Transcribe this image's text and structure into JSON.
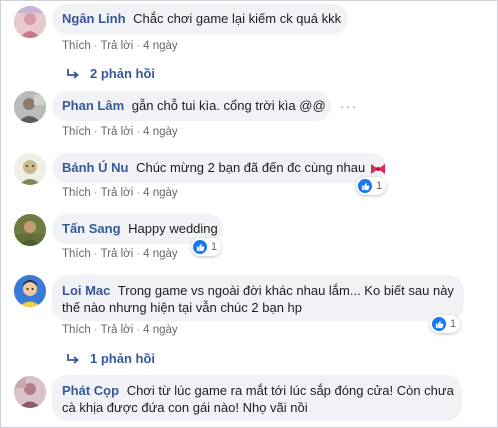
{
  "actions": {
    "like": "Thích",
    "reply": "Trả lời",
    "separator": "·"
  },
  "comments": [
    {
      "author": "Ngân Linh",
      "text": "Chắc chơi game lại kiếm ck quá kkk",
      "time": "4 ngày",
      "replies_label": "2 phản hồi"
    },
    {
      "author": "Phan Lâm",
      "text": "gẫn chỗ tui kìa. cổng trời kìa @@",
      "time": "4 ngày",
      "more": "···"
    },
    {
      "author": "Bánh Ú Nu",
      "text": "Chúc mừng 2 bạn đã đến đc cùng nhau",
      "time": "4 ngày",
      "reaction_count": "1",
      "emoji": "ribbon-icon"
    },
    {
      "author": "Tấn Sang",
      "text": "Happy wedding",
      "time": "4 ngày",
      "reaction_count": "1"
    },
    {
      "author": "Loi Mac",
      "text_line1": "Trong game vs ngoài đời khác nhau lắm... Ko biết sau này",
      "text_line2": "thế nào nhưng hiện tại vẫn chúc 2 bạn hp",
      "time": "4 ngày",
      "reaction_count": "1",
      "replies_label": "1 phản hồi"
    },
    {
      "author": "Phát Cọp",
      "text_line1": "Chơi từ lúc game ra mắt tới lúc sắp đóng cửa! Còn chưa",
      "text_line2": "cà khịa được đứa con gái nào! Nhọ vãi nồi"
    }
  ],
  "colors": {
    "name": "#385898",
    "bubble": "#f0f2f5",
    "like": "#1877f2",
    "meta": "#65676b"
  }
}
